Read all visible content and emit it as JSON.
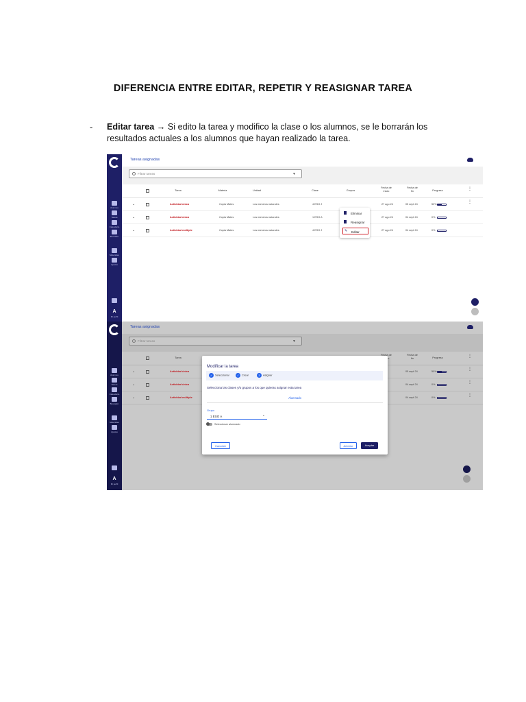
{
  "document": {
    "title": "DIFERENCIA ENTRE EDITAR, REPETIR Y REASIGNAR TAREA",
    "bullet_marker": "-",
    "lead_bold": "Editar tarea",
    "arrow": "→",
    "paragraph": "Si edito la tarea y modifico la clase o los alumnos, se le borrarán los resultados actuales a los alumnos que hayan realizado la tarea."
  },
  "app": {
    "header_title": "Tareas asignadas",
    "filter_placeholder": "Filtrar tareas",
    "sidebar": {
      "items": [
        "Alumnos",
        "Tareas",
        "Calendario",
        "Buscador",
        "Materiales",
        "Ajustes"
      ],
      "profile_label": "Mi perfil",
      "profile_initial": "A"
    },
    "columns": [
      "Tarea",
      "Materia",
      "Unidad",
      "Clase",
      "Grupos",
      "Fecha de inicio",
      "Fecha de fin",
      "Progreso"
    ],
    "rows": [
      {
        "task": "Actividad única",
        "subject": "Copia Mates",
        "unit": "Los números naturales",
        "class": "4 ESO J",
        "start": "27 ago 24",
        "end": "05 sept 24",
        "progress_label": "50%",
        "progress": 0.5
      },
      {
        "task": "Actividad única",
        "subject": "Copia Mates",
        "unit": "Los números naturales",
        "class": "1 ESO A",
        "start": "27 ago 24",
        "end": "04 sept 24",
        "progress_label": "0%",
        "progress": 0.0
      },
      {
        "task": "Actividad múltiple",
        "subject": "Copia Mates",
        "unit": "Los números naturales",
        "class": "4 ESO J",
        "start": "27 ago 24",
        "end": "04 sept 24",
        "progress_label": "0%",
        "progress": 0.0
      }
    ],
    "context_menu": [
      "Eliminar",
      "Reasignar",
      "Editar"
    ]
  },
  "modal": {
    "title": "Modificar la tarea",
    "steps": [
      "Seleccionar",
      "Crear",
      "Asignar"
    ],
    "active_step_number": "3",
    "instruction": "Selecciona las clases y/o grupos a los que quieras asignar esta tarea",
    "tab_label": "Alumnado",
    "group_label": "Grupo",
    "group_value": "1 ESO A",
    "toggle_label": "Seleccionar alumnado",
    "cancel": "Cancelar",
    "previous": "Anterior",
    "accept": "Aceptar"
  },
  "colors": {
    "sidebar": "#1e1f66",
    "accent": "#2563eb",
    "task_red": "#c0161c",
    "highlight_red": "#d0222a"
  }
}
